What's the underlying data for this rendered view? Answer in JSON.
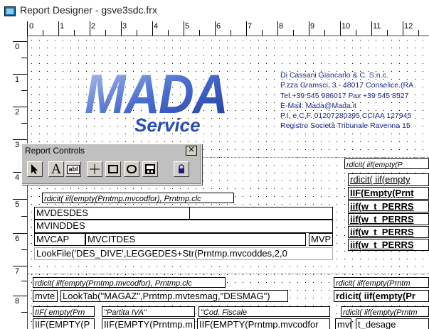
{
  "window": {
    "title": "Report Designer - gsve3sdc.frx"
  },
  "ruler": {
    "h_numbers": [
      "0",
      "1",
      "2",
      "3",
      "4",
      "5",
      "6",
      "7",
      "8",
      "9",
      "10",
      "11",
      "12"
    ],
    "v_numbers": [
      "0",
      "1",
      "2",
      "3",
      "4",
      "5",
      "6",
      "7",
      "8"
    ]
  },
  "logo": {
    "brand": "MADA",
    "sub": "Service"
  },
  "company_info": [
    "Di Cassani Giancarlo & C. S.n.c.",
    "P.zza Gramsci, 3 - 48017 Conselice (RA",
    "Tel.+39 545 986017 Fax +39  545 8527",
    "E-Mail: Mada@Mada.it",
    "P.I. e C.F. 01207280395 CCIAA 127945",
    "Registro Società Tribunale Ravenna 15"
  ],
  "palette": {
    "title": "Report Controls",
    "close": "✕",
    "tools": [
      "pointer-tool",
      "label-tool",
      "field-tool",
      "line-tool",
      "rectangle-tool",
      "rounded-rectangle-tool",
      "picture-tool",
      "lock-tool"
    ],
    "label_glyph": "A",
    "field_glyph": "abl"
  },
  "fields": {
    "f1": "rdicit( iif(empty(Prntmp.mvcodfor), Prntmp.clc",
    "f2": "MVDESDES",
    "f3": "MVINDDES",
    "f4": "MVCAP",
    "f5": "MVCITDES",
    "f6": "MVP",
    "f7": "LookFile('DES_DIVE',LEGGEDES+Str(Prntmp.mvcoddes,2,0",
    "r0": "rdicit( iif(empty(P",
    "r1": "rdicit( iif(empty",
    "r2": "IIF(Empty(Prnt",
    "r3": "iif(w_t_PERRS",
    "r4": "iif(w_t_PERRS",
    "r5": "iif(w_t_PERRS",
    "r6": "iif(w_t_PERRS",
    "b1": "rdicit( iif(empty(Prntmp.mvcodfor), Prntmp.clc",
    "b2": "mvte",
    "b3": "LookTab(\"MAGAZ\",Prntmp.mvtesmag,\"DESMAG\")",
    "b4": "rdicit( iif(empty(Prntm",
    "b5": "rdicit( iif(empty(Pr",
    "c1": "IIF( empty(Prn",
    "c2": "\"Partita IVA\"",
    "c3": "\"Cod. Fiscale",
    "c4": "rdicit( iif(empty(Prntm",
    "d1": "IIF(EMPTY(P",
    "d2": "IIF(EMPTY(Prntmp.m",
    "d3": "IIF(EMPTY(Prntmp.mvcodfor",
    "d4": "mvt",
    "d5": "t_desage"
  }
}
